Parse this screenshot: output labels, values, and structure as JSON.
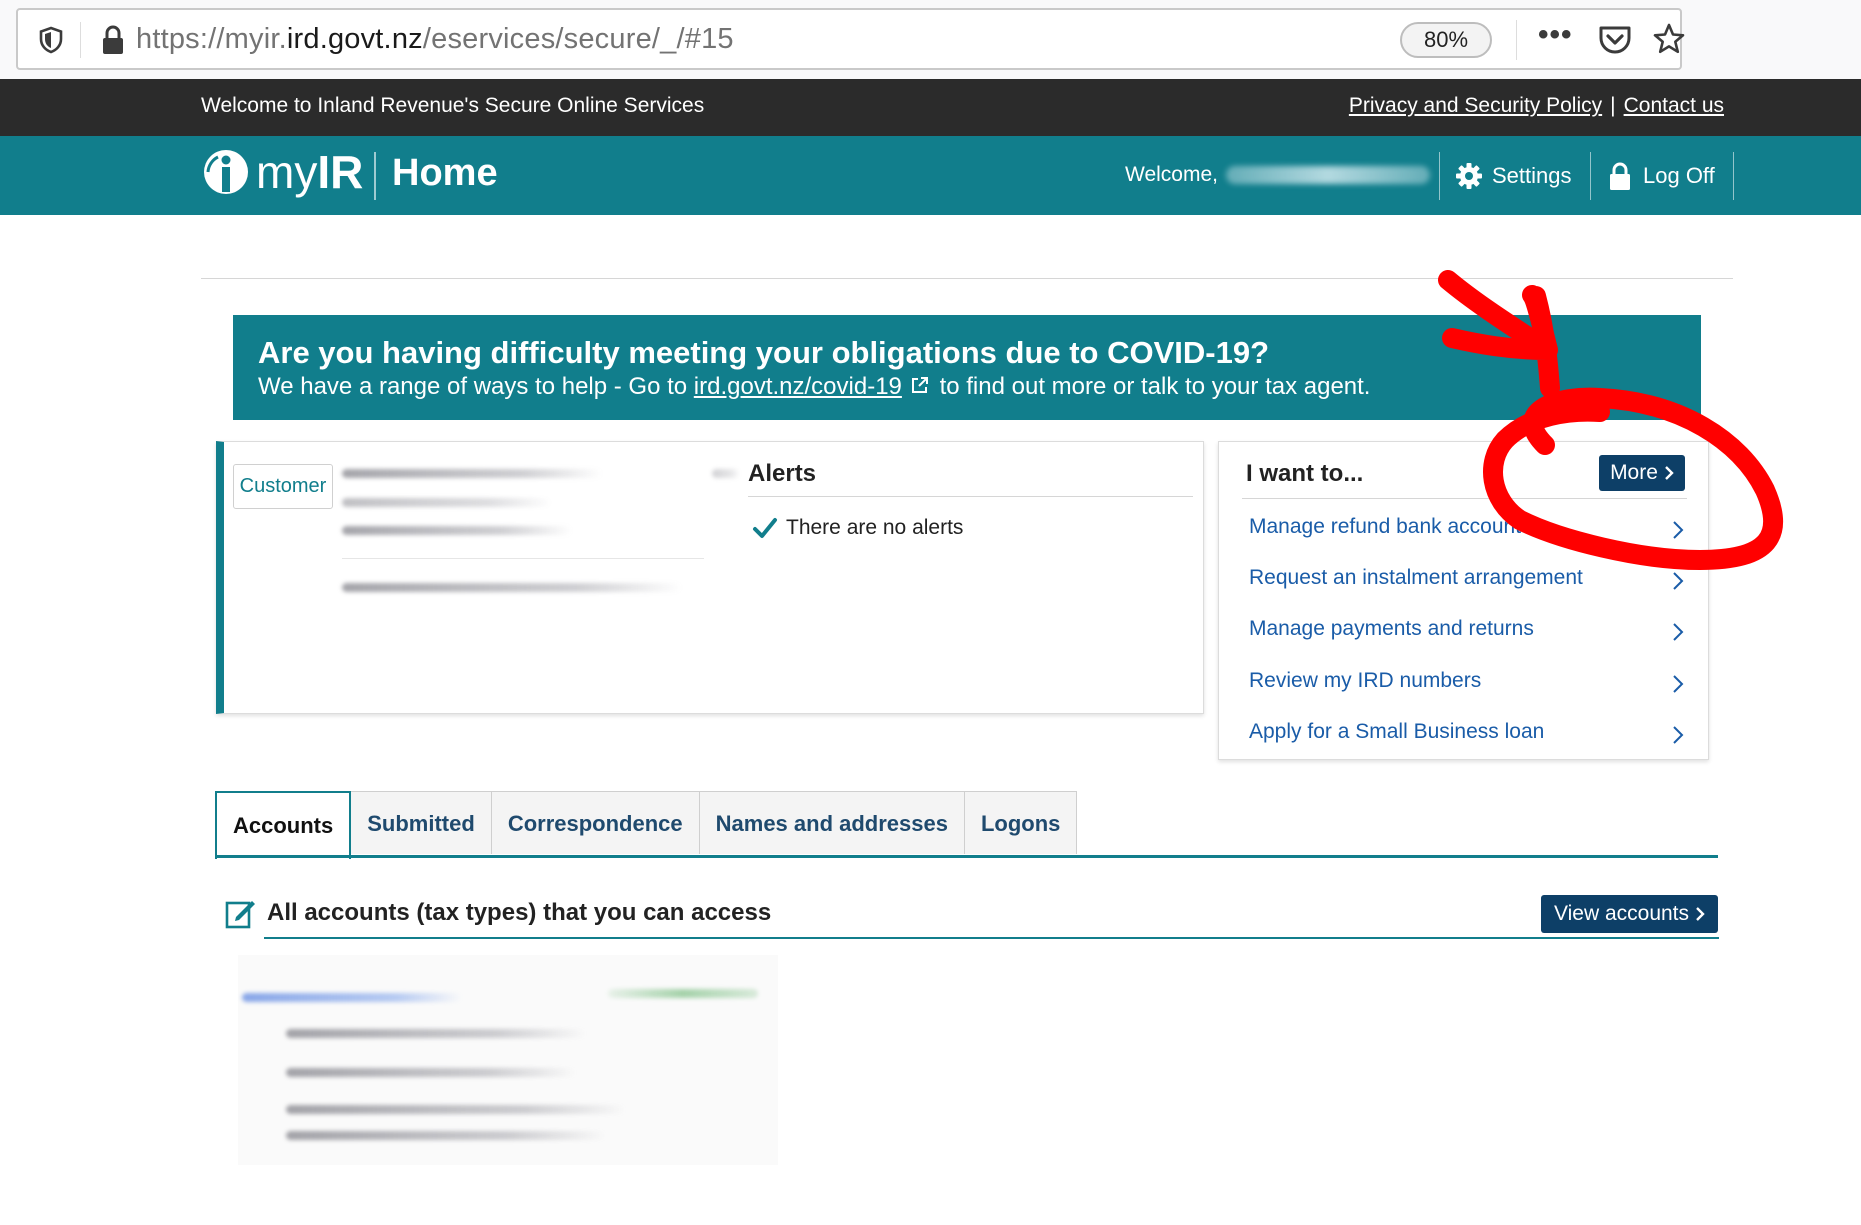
{
  "browser": {
    "url_prefix": "https://myir.",
    "url_domain": "ird.govt.nz",
    "url_path": "/eservices/secure/_/#15",
    "zoom": "80%",
    "menu_dots": "•••"
  },
  "top_bar": {
    "welcome": "Welcome to Inland Revenue's Secure Online Services",
    "privacy_link": "Privacy and Security Policy",
    "separator": "|",
    "contact_link": "Contact us"
  },
  "header": {
    "logo_my": "my",
    "logo_ir": "IR",
    "page_title": "Home",
    "welcome": "Welcome,",
    "settings_label": "Settings",
    "logoff_label": "Log Off"
  },
  "covid_banner": {
    "heading": "Are you having difficulty meeting your obligations due to COVID-19?",
    "text_before": "We have a range of ways to help - Go to ",
    "link": "ird.govt.nz/covid-19",
    "text_after": " to find out more or talk to your tax agent."
  },
  "customer_card": {
    "tag": "Customer",
    "alerts_title": "Alerts",
    "alerts_message": "There are no alerts"
  },
  "want_card": {
    "title": "I want to...",
    "more_label": "More",
    "items": [
      {
        "label": "Manage refund bank accounts"
      },
      {
        "label": "Request an instalment arrangement"
      },
      {
        "label": "Manage payments and returns"
      },
      {
        "label": "Review my IRD numbers"
      },
      {
        "label": "Apply for a Small Business loan"
      }
    ]
  },
  "tabs": [
    {
      "label": "Accounts",
      "active": true
    },
    {
      "label": "Submitted",
      "active": false
    },
    {
      "label": "Correspondence",
      "active": false
    },
    {
      "label": "Names and addresses",
      "active": false
    },
    {
      "label": "Logons",
      "active": false
    }
  ],
  "accounts": {
    "title": "All accounts (tax types) that you can access",
    "view_label": "View accounts"
  },
  "colors": {
    "teal": "#117e8c",
    "navy": "#0d3f67",
    "link_blue": "#1a5ca8",
    "annotation_red": "#ff0000"
  }
}
